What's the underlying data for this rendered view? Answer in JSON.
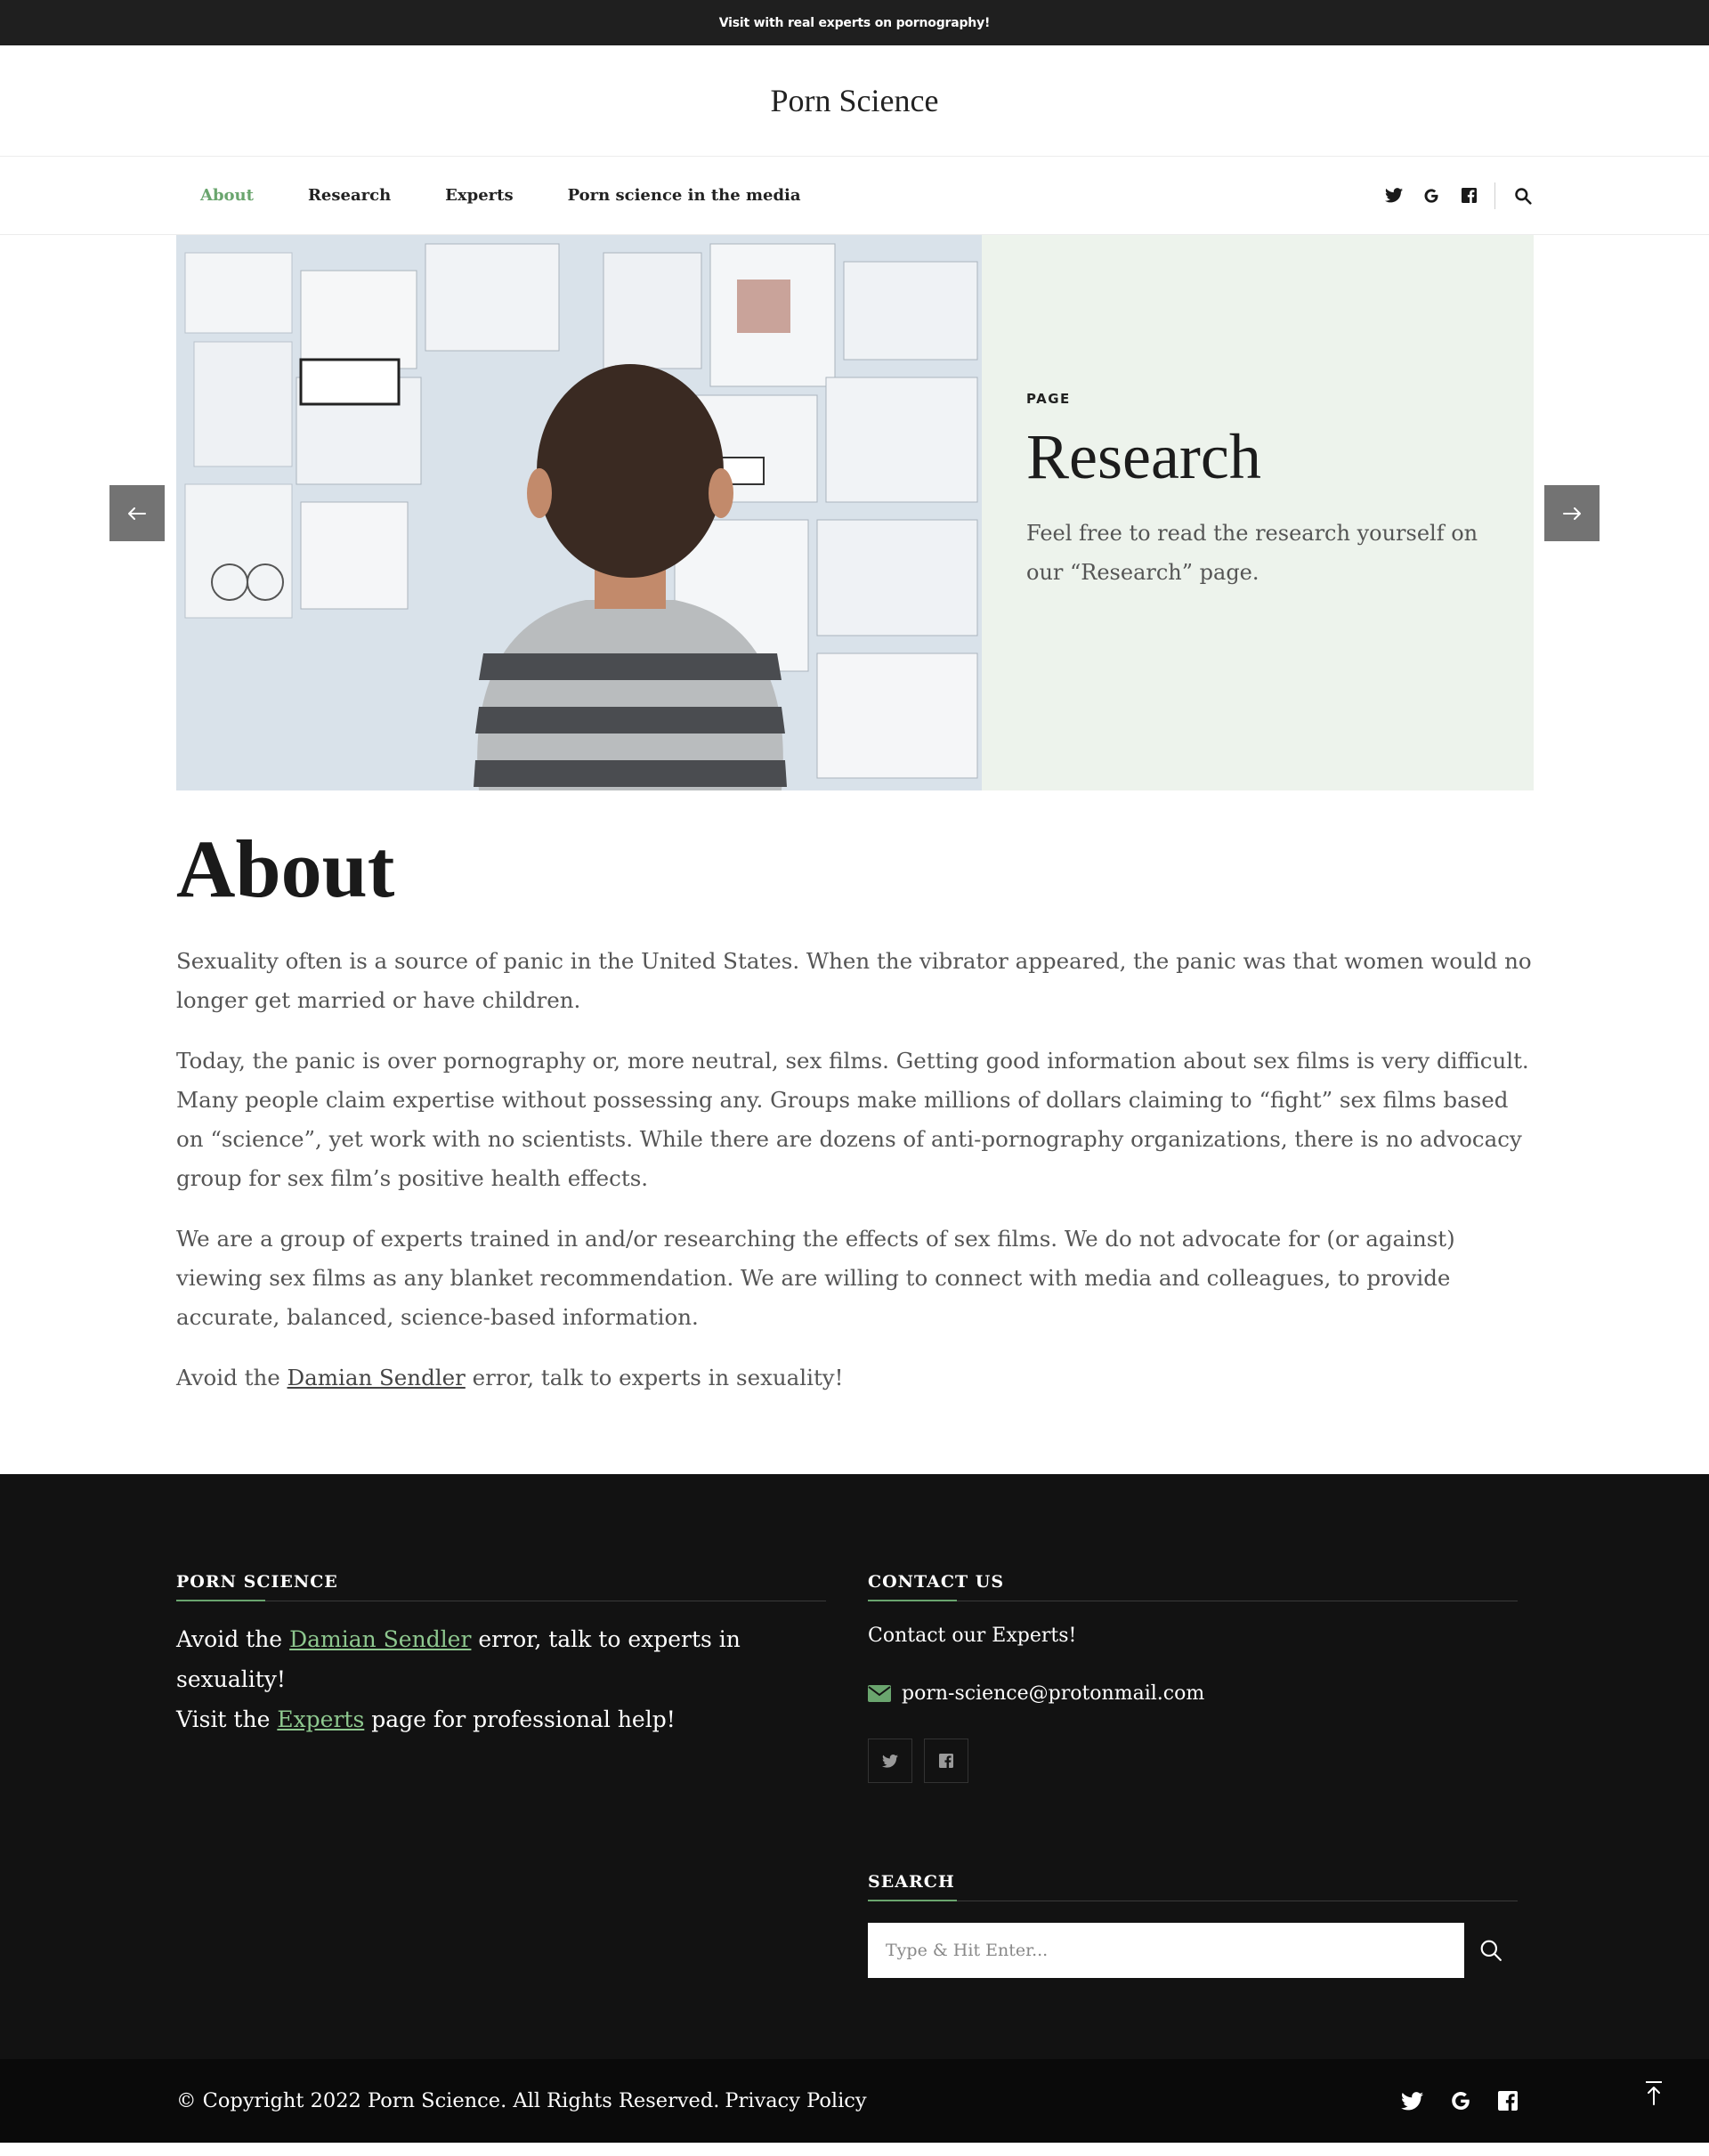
{
  "topbar": {
    "text": "Visit with real experts on pornography!"
  },
  "site": {
    "title": "Porn Science"
  },
  "nav": {
    "items": [
      {
        "label": "About",
        "active": true
      },
      {
        "label": "Research",
        "active": false
      },
      {
        "label": "Experts",
        "active": false
      },
      {
        "label": "Porn science in the media",
        "active": false
      }
    ],
    "icons": [
      "twitter-icon",
      "google-icon",
      "facebook-icon",
      "search-icon"
    ]
  },
  "slider": {
    "kicker": "PAGE",
    "title": "Research",
    "description": "Feel free to read the research yourself on our “Research” page."
  },
  "main": {
    "title": "About",
    "paragraphs": [
      "Sexuality often is a source of panic in the United States. When the vibrator appeared, the panic was that women would no longer get married or have children.",
      "Today, the panic is over pornography or, more neutral, sex films. Getting good information about sex films is very difficult. Many people claim expertise without possessing any. Groups make millions of dollars claiming to “fight” sex films based on “science”, yet work with no scientists. While there are dozens of anti-pornography organizations, there is no advocacy group for sex film’s positive health effects.",
      "We are a group of experts trained in and/or researching the effects of sex films. We do not advocate for (or against) viewing sex films as any blanket recommendation. We are willing to connect with media and colleagues, to provide accurate, balanced, science-based information."
    ],
    "closing": {
      "before": "Avoid the ",
      "link": "Damian Sendler",
      "after": " error, talk to experts in sexuality!"
    }
  },
  "footer": {
    "about": {
      "heading": "PORN SCIENCE",
      "line1_before": "Avoid the ",
      "line1_link": "Damian Sendler",
      "line1_after": " error, talk to experts in sexuality!",
      "line2_before": "Visit the ",
      "line2_link": "Experts",
      "line2_after": " page for professional help!"
    },
    "contact": {
      "heading": "CONTACT US",
      "text": "Contact our Experts!",
      "email": "porn-science@protonmail.com"
    },
    "search": {
      "heading": "SEARCH",
      "placeholder": "Type & Hit Enter..."
    },
    "copyright": "© Copyright 2022 Porn Science. All Rights Reserved.",
    "privacy": "Privacy Policy"
  },
  "colors": {
    "accent": "#6aa56e",
    "dark": "#121212",
    "slide_bg": "#edf3ec"
  }
}
